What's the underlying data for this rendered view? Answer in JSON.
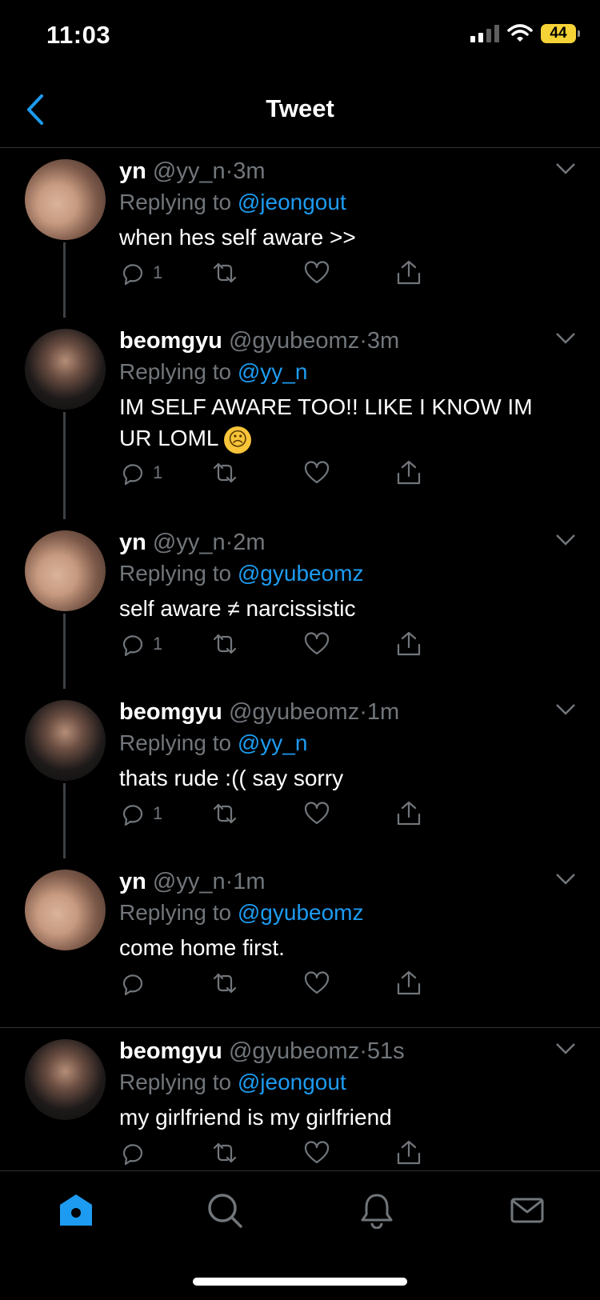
{
  "status_bar": {
    "time": "11:03",
    "battery": "44"
  },
  "nav": {
    "title": "Tweet"
  },
  "tweets": [
    {
      "name": "yn",
      "handle": "@yy_n",
      "dot": "·",
      "time": "3m",
      "reply_label": "Replying to",
      "reply_to": "@jeongout",
      "text": "when hes self aware >>",
      "reply_count": "1"
    },
    {
      "name": "beomgyu",
      "handle": "@gyubeomz",
      "dot": "·",
      "time": "3m",
      "reply_label": "Replying to",
      "reply_to": "@yy_n",
      "text": "IM SELF AWARE TOO!! LIKE I KNOW IM UR LOML",
      "reply_count": "1"
    },
    {
      "name": "yn",
      "handle": "@yy_n",
      "dot": "·",
      "time": "2m",
      "reply_label": "Replying to",
      "reply_to": "@gyubeomz",
      "text": "self aware ≠ narcissistic",
      "reply_count": "1"
    },
    {
      "name": "beomgyu",
      "handle": "@gyubeomz",
      "dot": "·",
      "time": "1m",
      "reply_label": "Replying to",
      "reply_to": "@yy_n",
      "text": "thats rude :(( say sorry",
      "reply_count": "1"
    },
    {
      "name": "yn",
      "handle": "@yy_n",
      "dot": "·",
      "time": "1m",
      "reply_label": "Replying to",
      "reply_to": "@gyubeomz",
      "text": "come home first.",
      "reply_count": ""
    },
    {
      "name": "beomgyu",
      "handle": "@gyubeomz",
      "dot": "·",
      "time": "51s",
      "reply_label": "Replying to",
      "reply_to": "@jeongout",
      "text": "my girlfriend is my girlfriend",
      "reply_count": ""
    }
  ],
  "tabs": [
    "home-icon",
    "search-icon",
    "notifications-icon",
    "messages-icon"
  ],
  "colors": {
    "accent": "#1d9bf0",
    "background": "#000000",
    "divider": "#2f3336",
    "muted": "#71767b"
  }
}
